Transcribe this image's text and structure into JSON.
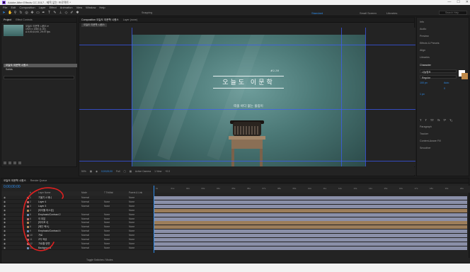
{
  "app": {
    "title": "Adobe After Effects CC 2017 - 제목 없는 프로젝트 *",
    "brand_color": "#9b6cff",
    "accent": "#2d8ceb",
    "window_buttons": [
      "—",
      "☐",
      "✕"
    ]
  },
  "menu": [
    "File",
    "Edit",
    "Composition",
    "Layer",
    "Effect",
    "Animation",
    "View",
    "Window",
    "Help"
  ],
  "toolbar": {
    "tools": [
      "selection-tool",
      "hand-tool",
      "zoom-tool",
      "rotate-tool",
      "camera-tool",
      "pan-behind-tool",
      "rectangle-tool",
      "pen-tool",
      "type-tool",
      "brush-tool",
      "clone-stamp-tool",
      "eraser-tool",
      "roto-brush-tool",
      "puppet-tool"
    ],
    "snapping_label": "Snapping",
    "workspaces": [
      "Standard",
      "Small Screen",
      "Libraries"
    ],
    "active_workspace": "Standard",
    "search_placeholder": "Search Help"
  },
  "project": {
    "tabs": [
      "Project",
      "Effect Controls"
    ],
    "active_tab": "Project",
    "info_lines": [
      "오늘도 이문학 시퀀스 ▾",
      "1920 x 1080 (1.00)",
      "Δ 0;00;10;00, 29.97 fps"
    ],
    "items": [
      "오늘도 이문학 시퀀스",
      "Solids"
    ],
    "selected_item": "오늘도 이문학 시퀀스"
  },
  "composition": {
    "tabs": [
      "Composition 오늘도 이문학 시퀀스",
      "Layer (none)"
    ],
    "breadcrumb": "오늘도 이문학 시퀀스",
    "episode_label": "#2.30",
    "title_text": "오늘도 이문학",
    "subtitle_text": "떠올 바다 없는 울림이",
    "bar": {
      "zoom": "50%",
      "timecode": "0;00;00;00",
      "resolution": "Full",
      "camera": "Active Camera",
      "views": "1 View",
      "exposure": "+0.0"
    }
  },
  "right_panel": {
    "items": [
      "Info",
      "Audio",
      "Preview",
      "Effects & Presets",
      "Align",
      "Libraries",
      "Character",
      "Paragraph",
      "Tracker",
      "Content-Aware Fill",
      "Smoother"
    ],
    "character": {
      "font": "나눔명조",
      "style": "Regular",
      "size": "100 px",
      "leading": "Auto",
      "tracking": "0",
      "stroke": "1 px",
      "fill_color": "#ffffff",
      "stroke_color": "#c08a4a"
    }
  },
  "timeline": {
    "comp_tab": "오늘도 이문학 시퀀스",
    "render_tab": "Render Queue",
    "current_time": "0;00;00;00",
    "columns": [
      "#",
      "Layer Name",
      "Mode",
      "T TrkMat",
      "Parent & Link"
    ],
    "layers": [
      {
        "num": "1",
        "name": "기울기 4 애니",
        "mode": "Normal",
        "trk": "",
        "parent": "None",
        "label_color": "#b26d6d",
        "bar_color": "#8a8fa8"
      },
      {
        "num": "2",
        "name": "Layer 4",
        "mode": "Normal",
        "trk": "None",
        "parent": "None",
        "label_color": "#b26d6d",
        "bar_color": "#8a8fa8"
      },
      {
        "num": "3",
        "name": "Layer 3",
        "mode": "Normal",
        "trk": "None",
        "parent": "None",
        "label_color": "#b26d6d",
        "bar_color": "#8a8fa8"
      },
      {
        "num": "4",
        "name": "[타이틀 마스킹]",
        "mode": "",
        "trk": "",
        "parent": "None",
        "label_color": "#b08a5a",
        "bar_color": "#9c7d5a"
      },
      {
        "num": "5",
        "name": "Emphasis/Contrast 2",
        "mode": "Normal",
        "trk": "None",
        "parent": "None",
        "label_color": "#6d8ab2",
        "bar_color": "#8a8fa8"
      },
      {
        "num": "6",
        "name": "이 부분",
        "mode": "Normal",
        "trk": "None",
        "parent": "None",
        "label_color": "#b26d6d",
        "bar_color": "#8a8fa8"
      },
      {
        "num": "7",
        "name": "[타이포 2]",
        "mode": "Normal",
        "trk": "None",
        "parent": "None",
        "label_color": "#b08a5a",
        "bar_color": "#9c7d5a"
      },
      {
        "num": "8",
        "name": "[메인 텍스]",
        "mode": "Normal",
        "trk": "None",
        "parent": "None",
        "label_color": "#b08a5a",
        "bar_color": "#9c7d5a"
      },
      {
        "num": "9",
        "name": "Emphasis/Contrast 4",
        "mode": "Normal",
        "trk": "None",
        "parent": "None",
        "label_color": "#6d8ab2",
        "bar_color": "#8a8fa8"
      },
      {
        "num": "10",
        "name": "가로",
        "mode": "Normal",
        "trk": "None",
        "parent": "None",
        "label_color": "#b26d6d",
        "bar_color": "#8a8fa8"
      },
      {
        "num": "11",
        "name": "2차 색상",
        "mode": "Normal",
        "trk": "None",
        "parent": "None",
        "label_color": "#b26d6d",
        "bar_color": "#8a8fa8"
      },
      {
        "num": "12",
        "name": "가로줄 양면",
        "mode": "Normal",
        "trk": "None",
        "parent": "None",
        "label_color": "#b26d6d",
        "bar_color": "#8a8fa8"
      },
      {
        "num": "13",
        "name": "Background",
        "mode": "Normal",
        "trk": "None",
        "parent": "None",
        "label_color": "#6d8ab2",
        "bar_color": "#8a8fa8"
      }
    ],
    "ruler_ticks": [
      "0s",
      "01s",
      "02s",
      "03s",
      "04s",
      "05s",
      "06s",
      "07s",
      "08s",
      "09s",
      "10s",
      "11s",
      "12s",
      "13s",
      "14s",
      "15s",
      "16s",
      "17s",
      "18s",
      "19s",
      "20s"
    ],
    "bottom_label": "Toggle Switches / Modes"
  }
}
